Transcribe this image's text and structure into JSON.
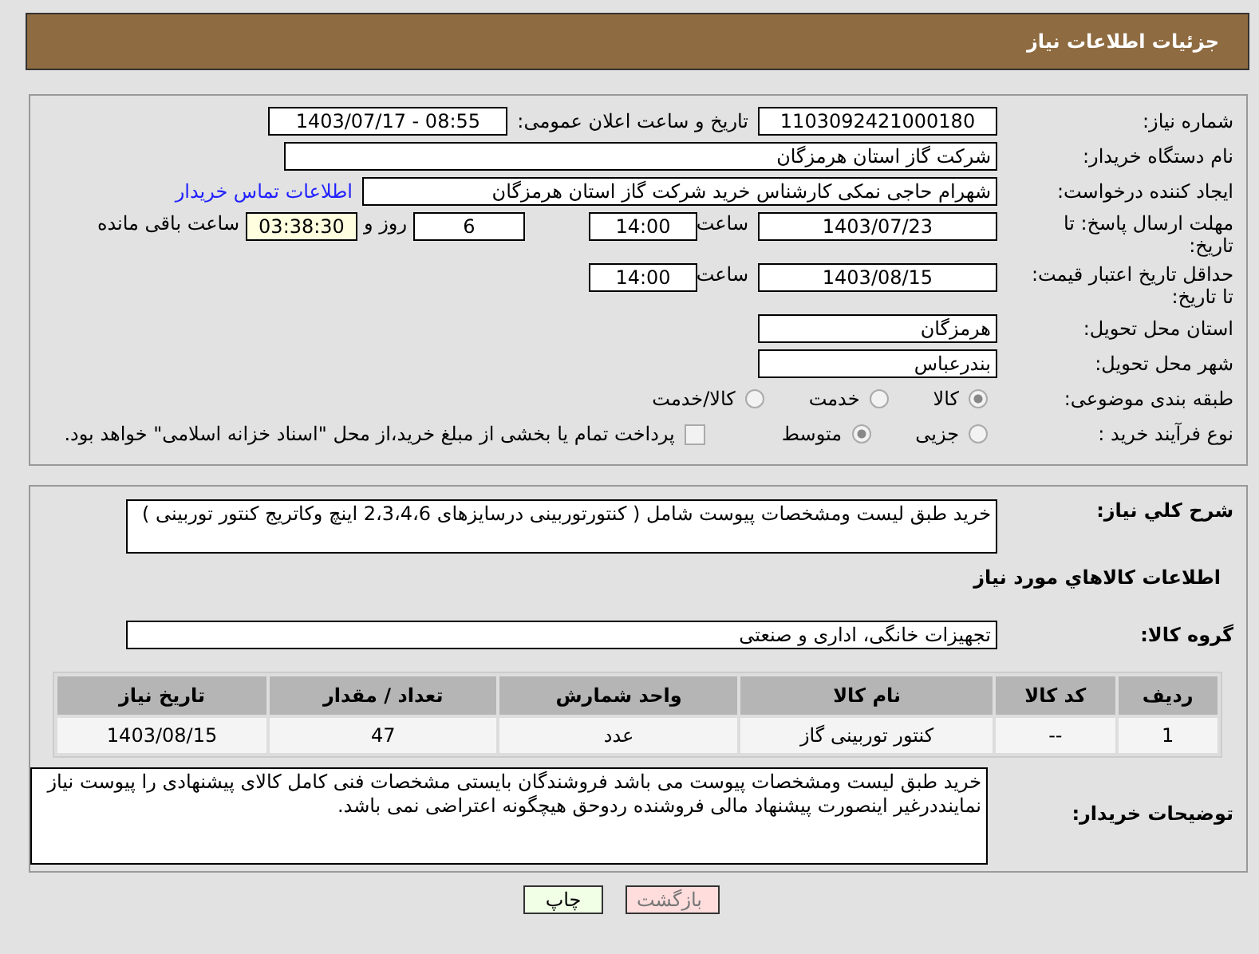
{
  "header": {
    "title": "جزئیات اطلاعات نیاز"
  },
  "need_number": {
    "label": "شماره نیاز:",
    "value": "1103092421000180"
  },
  "announce": {
    "label": "تاریخ و ساعت اعلان عمومی:",
    "value": "1403/07/17 - 08:55"
  },
  "buyer_org": {
    "label": "نام دستگاه خریدار:",
    "value": "شرکت گاز استان هرمزگان"
  },
  "creator": {
    "label": "ایجاد کننده درخواست:",
    "value": "شهرام حاجی نمکی کارشناس خرید شرکت گاز استان هرمزگان",
    "link": "اطلاعات تماس خریدار"
  },
  "reply_deadline": {
    "label": "مهلت ارسال پاسخ: تا تاریخ:",
    "date": "1403/07/23",
    "time_label": "ساعت",
    "time": "14:00",
    "days": "6",
    "days_label": "روز و",
    "remaining": "03:38:30",
    "remaining_label": "ساعت باقی مانده"
  },
  "price_validity": {
    "label": "حداقل تاریخ اعتبار قیمت: تا تاریخ:",
    "date": "1403/08/15",
    "time_label": "ساعت",
    "time": "14:00"
  },
  "province": {
    "label": "استان محل تحویل:",
    "value": "هرمزگان"
  },
  "city": {
    "label": "شهر محل تحویل:",
    "value": "بندرعباس"
  },
  "category": {
    "label": "طبقه بندی موضوعی:",
    "options": [
      {
        "label": "کالا",
        "selected": true
      },
      {
        "label": "خدمت",
        "selected": false
      },
      {
        "label": "کالا/خدمت",
        "selected": false
      }
    ]
  },
  "purchase_type": {
    "label": "نوع فرآیند خرید :",
    "options": [
      {
        "label": "جزیی",
        "selected": false
      },
      {
        "label": "متوسط",
        "selected": true
      }
    ],
    "payment": {
      "checked": false,
      "text": "پرداخت تمام یا بخشی از مبلغ خرید،از محل \"اسناد خزانه اسلامی\" خواهد بود."
    }
  },
  "description": {
    "label": "شرح کلي نياز:",
    "value": "خرید طبق لیست ومشخصات پیوست شامل ( کنتورتوربینی درسایزهای 2،3،4،6 اینچ وکاتریج کنتور توربینی )"
  },
  "goods_title": "اطلاعات کالاهاي مورد نياز",
  "goods_group": {
    "label": "گروه کالا:",
    "value": "تجهیزات خانگی، اداری و صنعتی"
  },
  "table": {
    "columns": [
      "ردیف",
      "کد کالا",
      "نام کالا",
      "واحد شمارش",
      "تعداد / مقدار",
      "تاریخ نیاز"
    ],
    "rows": [
      [
        "1",
        "--",
        "کنتور توربینی گاز",
        "عدد",
        "47",
        "1403/08/15"
      ]
    ]
  },
  "buyer_notes": {
    "label": "توضیحات خریدار:",
    "value": "خرید طبق لیست ومشخصات پیوست می باشد فروشندگان بایستی مشخصات فنی کامل کالای پیشنهادی را پیوست نیاز نماینددرغیر اینصورت پیشنهاد مالی فروشنده ردوحق هیچگونه اعتراضی نمی باشد."
  },
  "buttons": [
    {
      "label": "بازگشت",
      "kind": "back"
    },
    {
      "label": "چاپ",
      "kind": "print"
    }
  ]
}
